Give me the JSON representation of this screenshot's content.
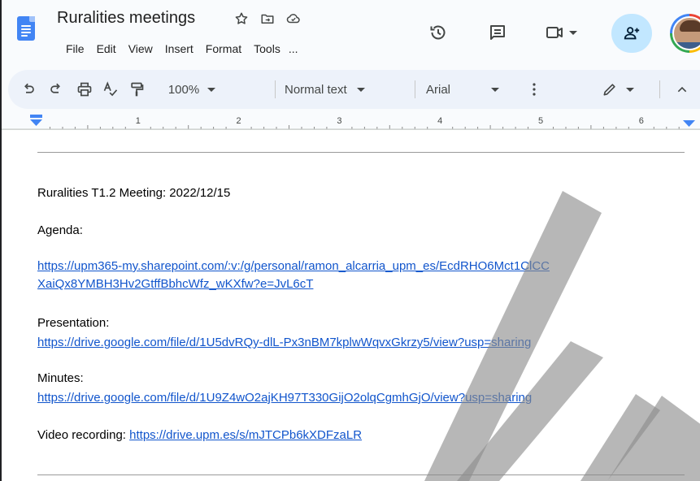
{
  "document": {
    "title": "Ruralities meetings"
  },
  "menu": {
    "items": [
      "File",
      "Edit",
      "View",
      "Insert",
      "Format",
      "Tools",
      "..."
    ]
  },
  "toolbar": {
    "zoom": "100%",
    "style": "Normal text",
    "font": "Arial"
  },
  "ruler": {
    "numbers": [
      "1",
      "2",
      "3",
      "4",
      "5",
      "6"
    ]
  },
  "content": {
    "heading": "Ruralities T1.2 Meeting: 2022/12/15",
    "agenda_label": "Agenda:",
    "agenda_link_line1": "https://upm365-my.sharepoint.com/:v:/g/personal/ramon_alcarria_upm_es/EcdRHO6Mct1ClCC",
    "agenda_link_line2": "XaiQx8YMBH3Hv2GtffBbhcWfz_wKXfw?e=JvL6cT",
    "presentation_label": "Presentation:",
    "presentation_link": "https://drive.google.com/file/d/1U5dvRQy-dlL-Px3nBM7kplwWqvxGkrzy5/view?usp=sharing",
    "minutes_label": "Minutes:",
    "minutes_link": "https://drive.google.com/file/d/1U9Z4wO2ajKH97T330GijO2olqCgmhGjO/view?usp=sharing",
    "video_label": "Video recording: ",
    "video_link": "https://drive.upm.es/s/mJTCPb6kXDFzaLR"
  },
  "icons": {
    "star": "star-icon",
    "move": "folder-move-icon",
    "cloud": "cloud-status-icon",
    "history": "history-icon",
    "comments": "comments-icon",
    "meet": "video-call-icon",
    "share": "share-add-person-icon",
    "undo": "undo-icon",
    "redo": "redo-icon",
    "print": "print-icon",
    "spellcheck": "spellcheck-icon",
    "paint": "paint-format-icon",
    "more": "more-vert-icon",
    "edit": "pencil-edit-icon",
    "collapse": "chevron-up-icon"
  },
  "colors": {
    "accent": "#4285f4",
    "link": "#1155cc",
    "toolbar_bg": "#edf2fa",
    "share_bg": "#c2e7ff"
  }
}
